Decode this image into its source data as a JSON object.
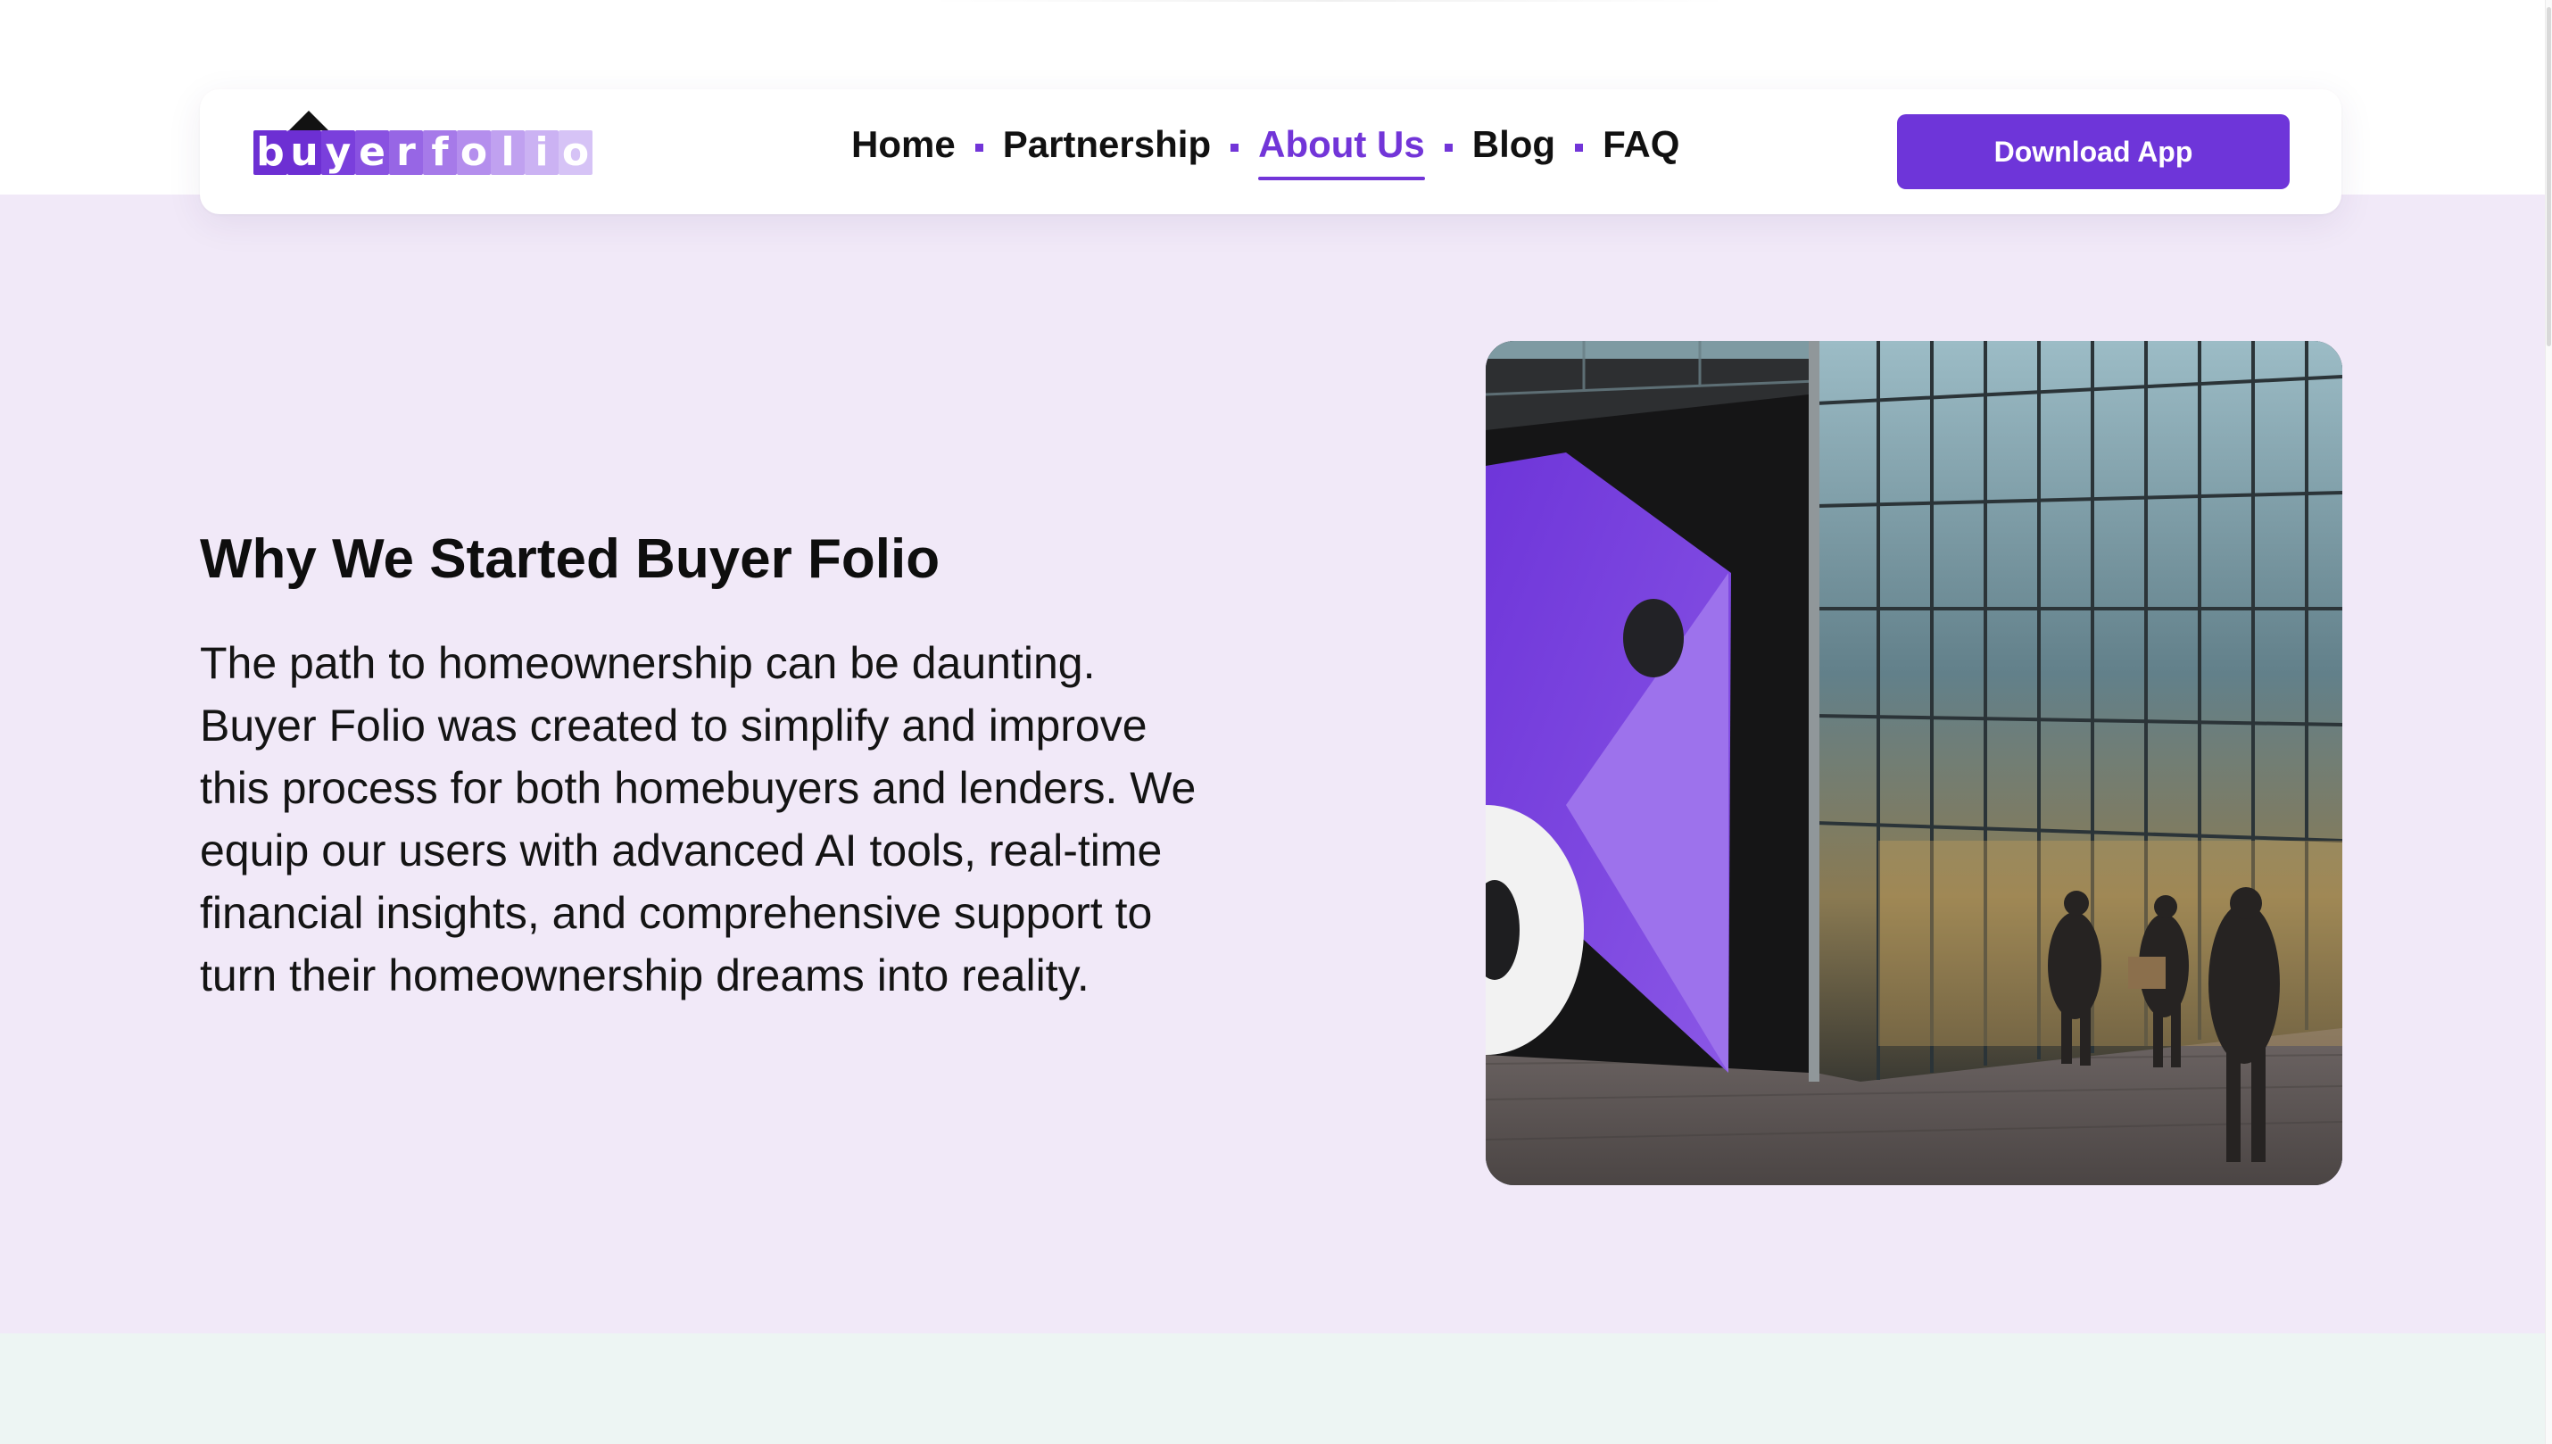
{
  "brand": {
    "logo_text": "buyerfolio",
    "logo_tiles": [
      "b",
      "u",
      "y",
      "e",
      "r",
      "f",
      "o",
      "l",
      "i",
      "o"
    ]
  },
  "nav": {
    "items": [
      {
        "label": "Home",
        "active": false
      },
      {
        "label": "Partnership",
        "active": false
      },
      {
        "label": "About Us",
        "active": true
      },
      {
        "label": "Blog",
        "active": false
      },
      {
        "label": "FAQ",
        "active": false
      }
    ],
    "cta_label": "Download App"
  },
  "hero": {
    "title": "Why We Started Buyer Folio",
    "lines": [
      "The path to homeownership can be daunting.",
      "Buyer Folio was created to simplify and improve",
      "this process for both homebuyers and lenders. We",
      "equip our users with advanced AI tools, real-time",
      "financial insights, and comprehensive support to",
      "turn their homeownership dreams into reality."
    ],
    "image_icon": "office-building-photo"
  },
  "colors": {
    "accent": "#6e35d9",
    "hero_background": "#f1e9f8",
    "next_section_background": "#edf5f3",
    "text": "#111111"
  }
}
